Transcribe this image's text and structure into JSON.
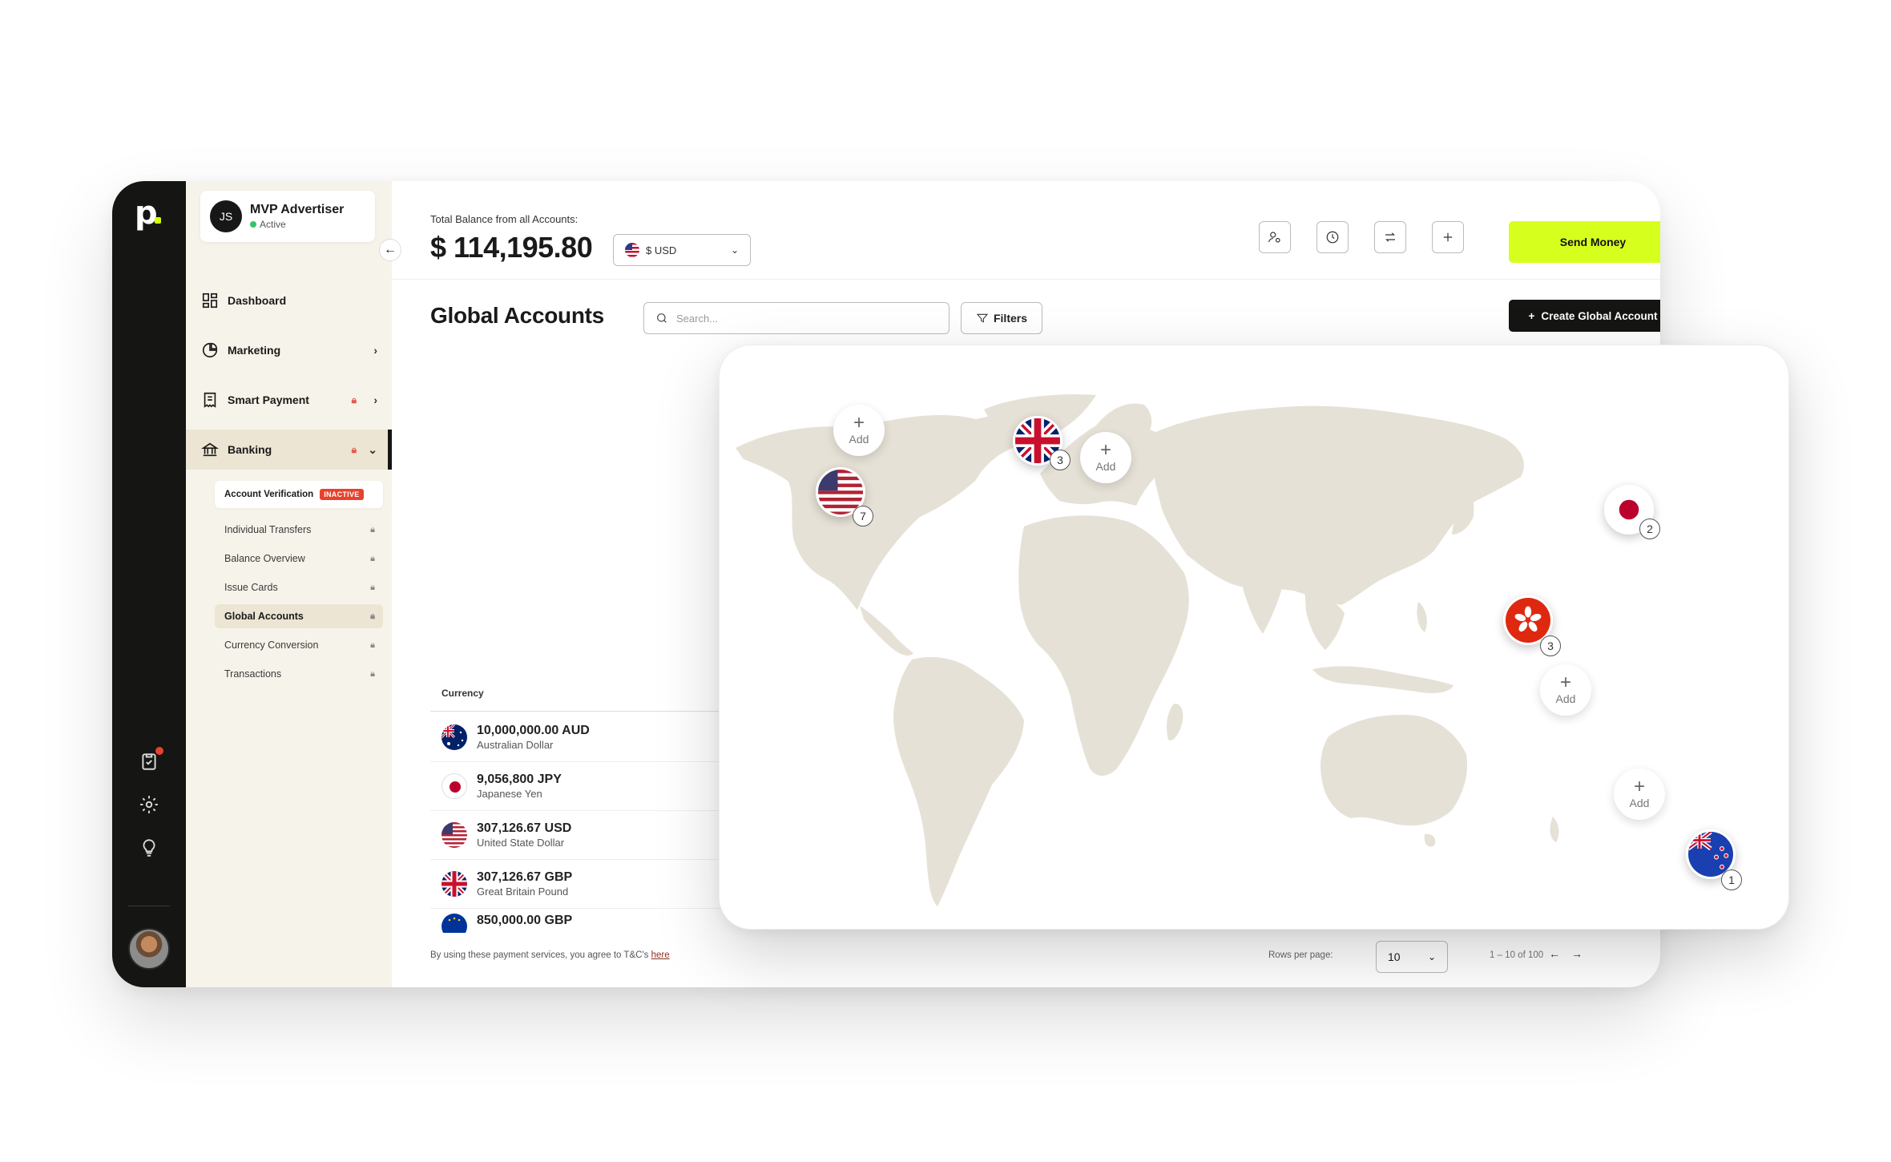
{
  "profile": {
    "initials": "JS",
    "name": "MVP Advertiser",
    "status": "Active"
  },
  "nav": {
    "dashboard": "Dashboard",
    "marketing": "Marketing",
    "smart_payment": "Smart Payment",
    "banking": "Banking"
  },
  "banking_sub": {
    "verification": "Account Verification",
    "verification_badge": "INACTIVE",
    "items": [
      "Individual Transfers",
      "Balance Overview",
      "Issue Cards",
      "Global Accounts",
      "Currency Conversion",
      "Transactions"
    ]
  },
  "header": {
    "balance_label": "Total Balance from all Accounts:",
    "balance_value": "$ 114,195.80",
    "currency": "$ USD",
    "send_money": "Send Money"
  },
  "page": {
    "title": "Global Accounts",
    "search_placeholder": "Search...",
    "filters": "Filters",
    "create": "Create Global Account"
  },
  "table": {
    "header": "Currency",
    "rows": [
      {
        "amount": "10,000,000.00 AUD",
        "name": "Australian Dollar",
        "flag": "au"
      },
      {
        "amount": "9,056,800 JPY",
        "name": "Japanese Yen",
        "flag": "jp"
      },
      {
        "amount": "307,126.67 USD",
        "name": "United State Dollar",
        "flag": "us"
      },
      {
        "amount": "307,126.67 GBP",
        "name": "Great Britain Pound",
        "flag": "gb"
      },
      {
        "amount": "850,000.00 GBP",
        "name": "",
        "flag": "eu"
      }
    ]
  },
  "footer": {
    "note": "By using these payment services, you agree to T&C's",
    "link": "here",
    "rows_per_page_label": "Rows per page:",
    "rows_per_page": "10",
    "range": "1 – 10 of 100",
    "prev": "←",
    "next": "→"
  },
  "map": {
    "add_label": "Add",
    "pins": [
      {
        "flag": "us",
        "count": "7"
      },
      {
        "flag": "gb",
        "count": "3"
      },
      {
        "flag": "jp",
        "count": "2"
      },
      {
        "flag": "hk",
        "count": "3"
      },
      {
        "flag": "nz",
        "count": "1"
      }
    ]
  },
  "colors": {
    "accent": "#d7ff1d",
    "dark": "#151513",
    "sidebar": "#f6f3ea",
    "danger": "#e8412c",
    "land": "#e6e1d6"
  }
}
